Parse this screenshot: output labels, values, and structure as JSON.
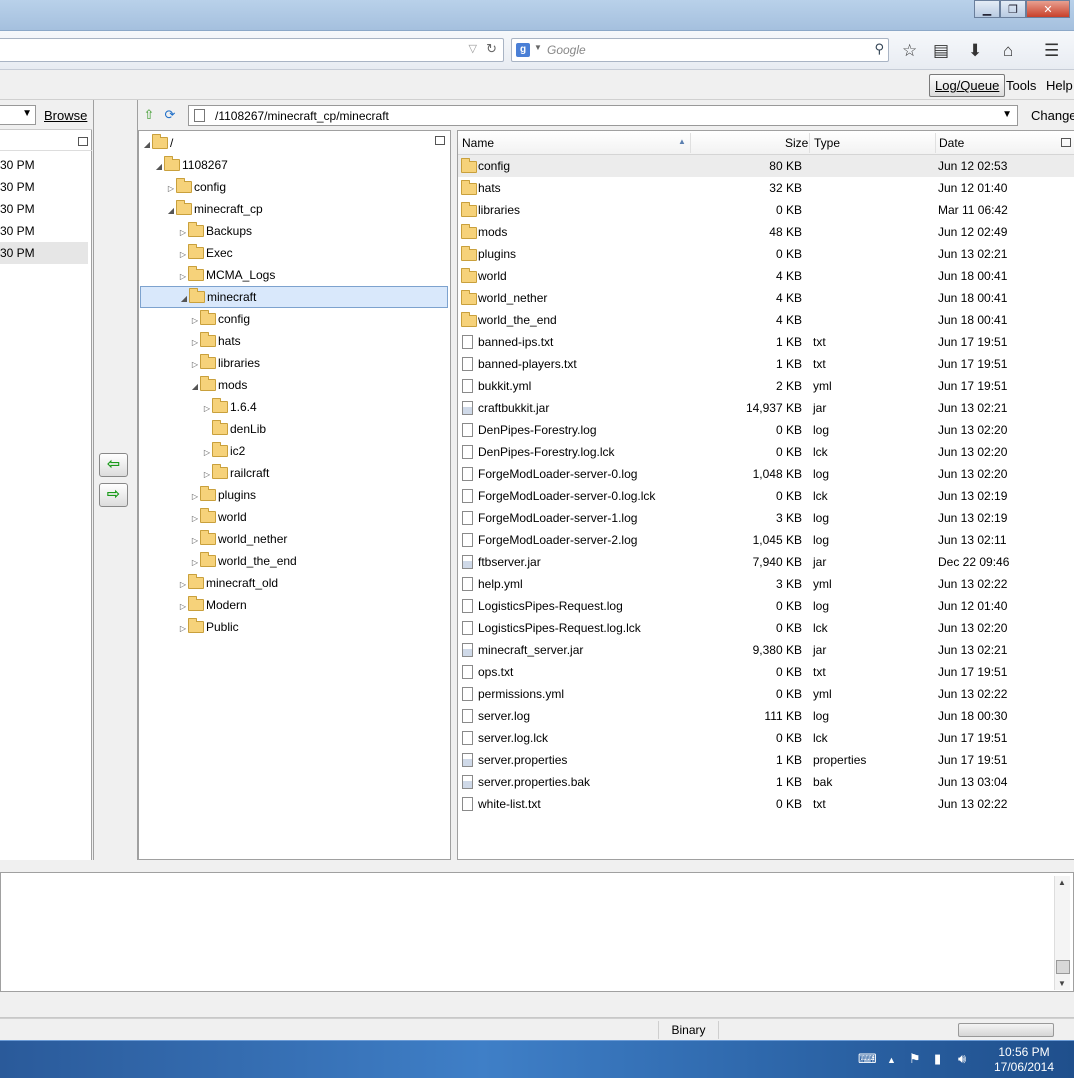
{
  "window": {
    "minimize": "▁",
    "maximize": "❐",
    "close": "✕"
  },
  "browser": {
    "search_engine_letter": "g",
    "search_placeholder": "Google"
  },
  "menu": {
    "log_queue": "Log/Queue",
    "tools": "Tools",
    "help": "Help"
  },
  "local": {
    "browse": "Browse",
    "rows": [
      "30 PM",
      "30 PM",
      "30 PM",
      "30 PM",
      "30 PM"
    ]
  },
  "remote": {
    "path": "/1108267/minecraft_cp/minecraft",
    "change": "Change",
    "tree": [
      {
        "label": "/",
        "depth": 0,
        "twisty": "open"
      },
      {
        "label": "1108267",
        "depth": 1,
        "twisty": "open"
      },
      {
        "label": "config",
        "depth": 2,
        "twisty": "closed"
      },
      {
        "label": "minecraft_cp",
        "depth": 2,
        "twisty": "open"
      },
      {
        "label": "Backups",
        "depth": 3,
        "twisty": "closed"
      },
      {
        "label": "Exec",
        "depth": 3,
        "twisty": "closed"
      },
      {
        "label": "MCMA_Logs",
        "depth": 3,
        "twisty": "closed"
      },
      {
        "label": "minecraft",
        "depth": 3,
        "twisty": "open",
        "selected": true
      },
      {
        "label": "config",
        "depth": 4,
        "twisty": "closed"
      },
      {
        "label": "hats",
        "depth": 4,
        "twisty": "closed"
      },
      {
        "label": "libraries",
        "depth": 4,
        "twisty": "closed"
      },
      {
        "label": "mods",
        "depth": 4,
        "twisty": "open"
      },
      {
        "label": "1.6.4",
        "depth": 5,
        "twisty": "closed"
      },
      {
        "label": "denLib",
        "depth": 5,
        "twisty": "none"
      },
      {
        "label": "ic2",
        "depth": 5,
        "twisty": "closed"
      },
      {
        "label": "railcraft",
        "depth": 5,
        "twisty": "closed"
      },
      {
        "label": "plugins",
        "depth": 4,
        "twisty": "closed"
      },
      {
        "label": "world",
        "depth": 4,
        "twisty": "closed"
      },
      {
        "label": "world_nether",
        "depth": 4,
        "twisty": "closed"
      },
      {
        "label": "world_the_end",
        "depth": 4,
        "twisty": "closed"
      },
      {
        "label": "minecraft_old",
        "depth": 3,
        "twisty": "closed"
      },
      {
        "label": "Modern",
        "depth": 3,
        "twisty": "closed"
      },
      {
        "label": "Public",
        "depth": 3,
        "twisty": "closed"
      }
    ],
    "columns": {
      "name": "Name",
      "size": "Size",
      "type": "Type",
      "date": "Date"
    },
    "files": [
      {
        "name": "config",
        "size": "80 KB",
        "type": "",
        "date": "Jun 12 02:53",
        "kind": "folder"
      },
      {
        "name": "hats",
        "size": "32 KB",
        "type": "",
        "date": "Jun 12 01:40",
        "kind": "folder"
      },
      {
        "name": "libraries",
        "size": "0 KB",
        "type": "",
        "date": "Mar 11 06:42",
        "kind": "folder"
      },
      {
        "name": "mods",
        "size": "48 KB",
        "type": "",
        "date": "Jun 12 02:49",
        "kind": "folder"
      },
      {
        "name": "plugins",
        "size": "0 KB",
        "type": "",
        "date": "Jun 13 02:21",
        "kind": "folder"
      },
      {
        "name": "world",
        "size": "4 KB",
        "type": "",
        "date": "Jun 18 00:41",
        "kind": "folder"
      },
      {
        "name": "world_nether",
        "size": "4 KB",
        "type": "",
        "date": "Jun 18 00:41",
        "kind": "folder"
      },
      {
        "name": "world_the_end",
        "size": "4 KB",
        "type": "",
        "date": "Jun 18 00:41",
        "kind": "folder"
      },
      {
        "name": "banned-ips.txt",
        "size": "1 KB",
        "type": "txt",
        "date": "Jun 17 19:51",
        "kind": "file"
      },
      {
        "name": "banned-players.txt",
        "size": "1 KB",
        "type": "txt",
        "date": "Jun 17 19:51",
        "kind": "file"
      },
      {
        "name": "bukkit.yml",
        "size": "2 KB",
        "type": "yml",
        "date": "Jun 17 19:51",
        "kind": "file"
      },
      {
        "name": "craftbukkit.jar",
        "size": "14,937 KB",
        "type": "jar",
        "date": "Jun 13 02:21",
        "kind": "jar"
      },
      {
        "name": "DenPipes-Forestry.log",
        "size": "0 KB",
        "type": "log",
        "date": "Jun 13 02:20",
        "kind": "file"
      },
      {
        "name": "DenPipes-Forestry.log.lck",
        "size": "0 KB",
        "type": "lck",
        "date": "Jun 13 02:20",
        "kind": "file"
      },
      {
        "name": "ForgeModLoader-server-0.log",
        "size": "1,048 KB",
        "type": "log",
        "date": "Jun 13 02:20",
        "kind": "file"
      },
      {
        "name": "ForgeModLoader-server-0.log.lck",
        "size": "0 KB",
        "type": "lck",
        "date": "Jun 13 02:19",
        "kind": "file"
      },
      {
        "name": "ForgeModLoader-server-1.log",
        "size": "3 KB",
        "type": "log",
        "date": "Jun 13 02:19",
        "kind": "file"
      },
      {
        "name": "ForgeModLoader-server-2.log",
        "size": "1,045 KB",
        "type": "log",
        "date": "Jun 13 02:11",
        "kind": "file"
      },
      {
        "name": "ftbserver.jar",
        "size": "7,940 KB",
        "type": "jar",
        "date": "Dec 22 09:46",
        "kind": "jar"
      },
      {
        "name": "help.yml",
        "size": "3 KB",
        "type": "yml",
        "date": "Jun 13 02:22",
        "kind": "file"
      },
      {
        "name": "LogisticsPipes-Request.log",
        "size": "0 KB",
        "type": "log",
        "date": "Jun 12 01:40",
        "kind": "file"
      },
      {
        "name": "LogisticsPipes-Request.log.lck",
        "size": "0 KB",
        "type": "lck",
        "date": "Jun 13 02:20",
        "kind": "file"
      },
      {
        "name": "minecraft_server.jar",
        "size": "9,380 KB",
        "type": "jar",
        "date": "Jun 13 02:21",
        "kind": "jar"
      },
      {
        "name": "ops.txt",
        "size": "0 KB",
        "type": "txt",
        "date": "Jun 17 19:51",
        "kind": "file"
      },
      {
        "name": "permissions.yml",
        "size": "0 KB",
        "type": "yml",
        "date": "Jun 13 02:22",
        "kind": "file"
      },
      {
        "name": "server.log",
        "size": "111 KB",
        "type": "log",
        "date": "Jun 18 00:30",
        "kind": "file"
      },
      {
        "name": "server.log.lck",
        "size": "0 KB",
        "type": "lck",
        "date": "Jun 17 19:51",
        "kind": "file"
      },
      {
        "name": "server.properties",
        "size": "1 KB",
        "type": "properties",
        "date": "Jun 17 19:51",
        "kind": "jar"
      },
      {
        "name": "server.properties.bak",
        "size": "1 KB",
        "type": "bak",
        "date": "Jun 13 03:04",
        "kind": "jar"
      },
      {
        "name": "white-list.txt",
        "size": "0 KB",
        "type": "txt",
        "date": "Jun 13 02:22",
        "kind": "file"
      }
    ]
  },
  "status": {
    "mode": "Binary"
  },
  "taskbar": {
    "time": "10:56 PM",
    "date": "17/06/2014"
  },
  "colors": {
    "selection": "#d9e8fb",
    "folder": "#f6d27a",
    "taskbar": "#2f69ad"
  }
}
